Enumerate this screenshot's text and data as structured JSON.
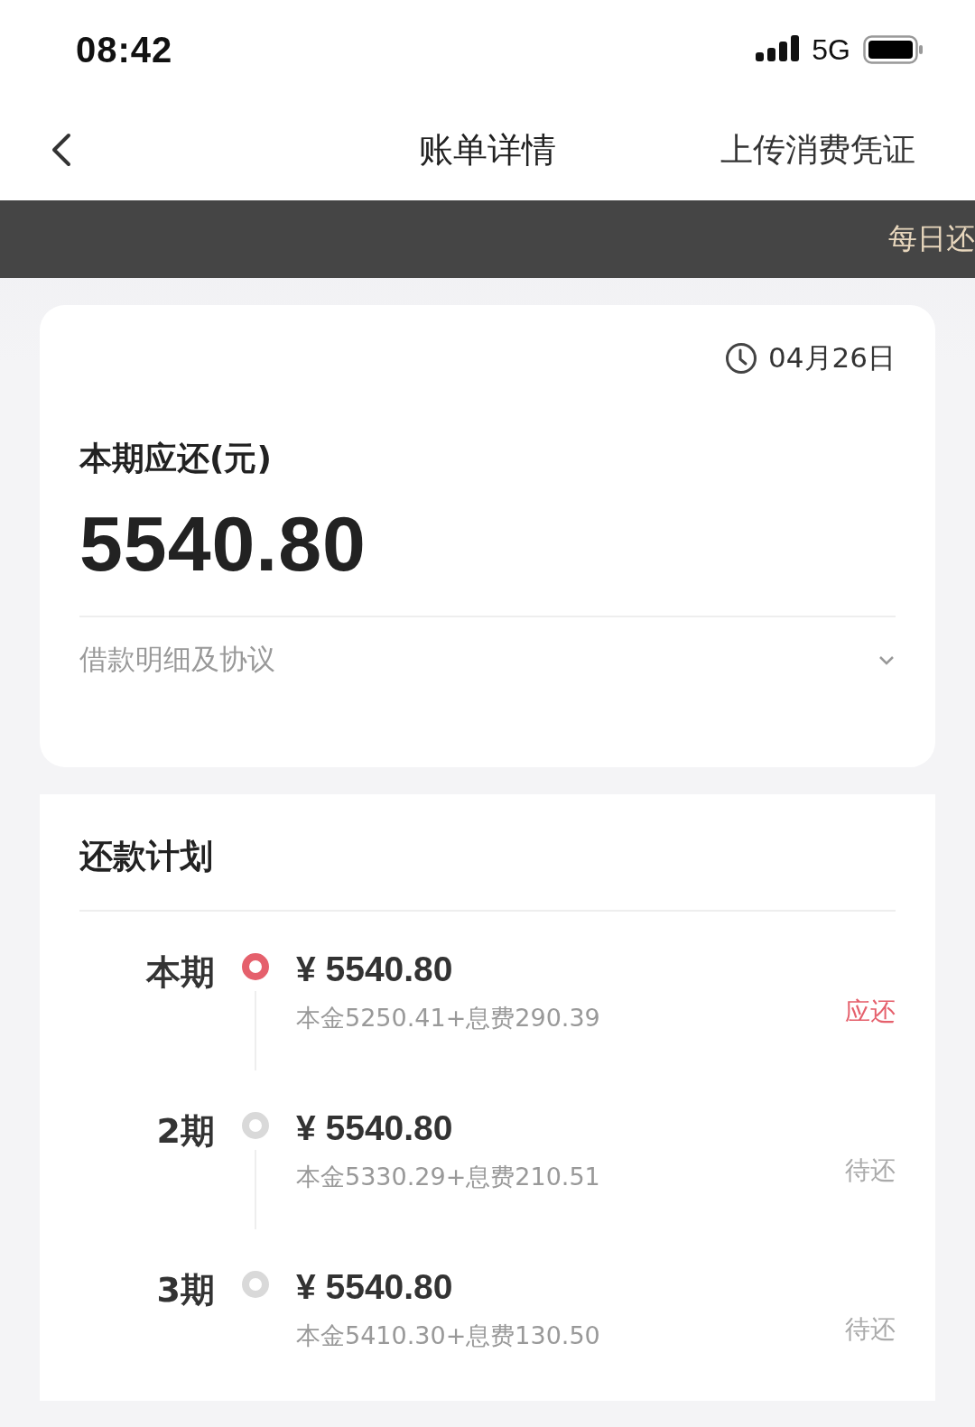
{
  "status_bar": {
    "time": "08:42",
    "network": "5G"
  },
  "nav": {
    "title": "账单详情",
    "action": "上传消费凭证"
  },
  "banner": {
    "text": "每日还"
  },
  "bill": {
    "due_date": "04月26日",
    "label": "本期应还(元)",
    "amount": "5540.80",
    "details_link": "借款明细及协议",
    "expanded": false
  },
  "plan": {
    "title": "还款计划",
    "items": [
      {
        "period": "本期",
        "amount": "¥ 5540.80",
        "breakdown": "本金5250.41+息费290.39",
        "status": "应还",
        "current": true
      },
      {
        "period": "2期",
        "amount": "¥ 5540.80",
        "breakdown": "本金5330.29+息费210.51",
        "status": "待还",
        "current": false
      },
      {
        "period": "3期",
        "amount": "¥ 5540.80",
        "breakdown": "本金5410.30+息费130.50",
        "status": "待还",
        "current": false
      }
    ]
  }
}
